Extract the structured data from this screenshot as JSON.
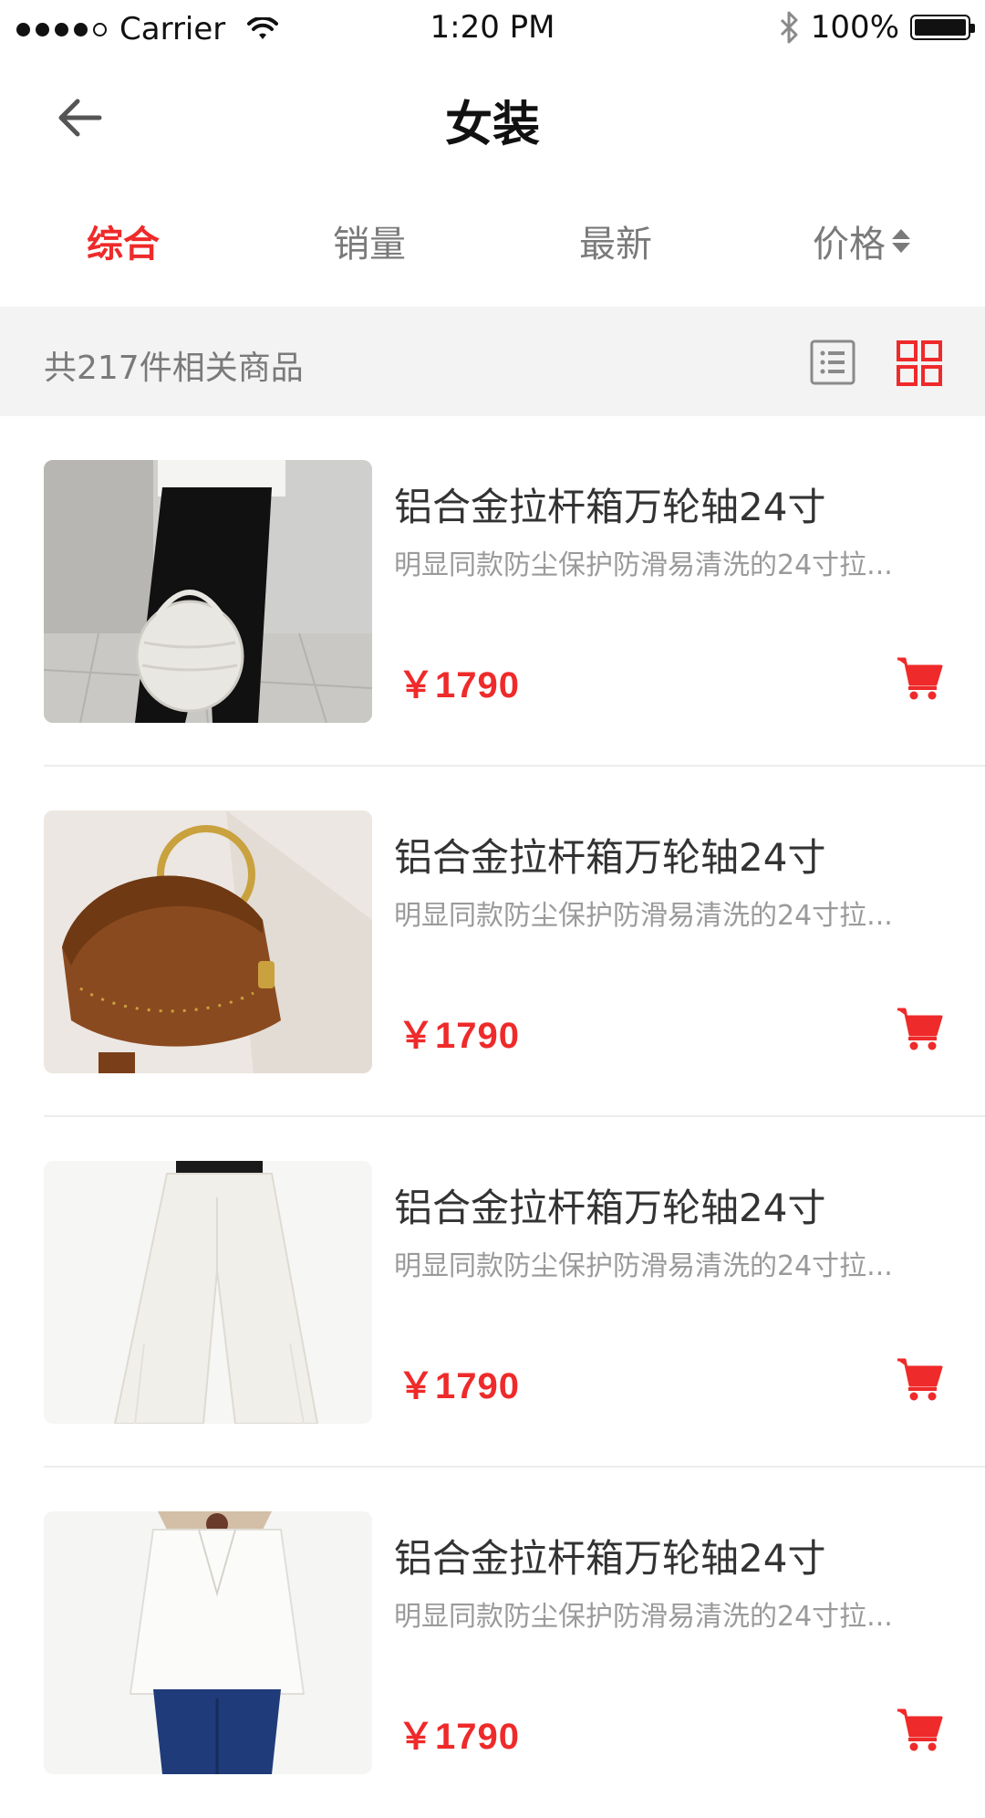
{
  "status": {
    "carrier": "Carrier",
    "time": "1:20 PM",
    "battery": "100%"
  },
  "nav": {
    "title": "女装"
  },
  "tabs": [
    "综合",
    "销量",
    "最新",
    "价格"
  ],
  "filter": {
    "count": "共217件相关商品"
  },
  "products": [
    {
      "name": "铝合金拉杆箱万轮轴24寸",
      "desc": "明显同款防尘保护防滑易清洗的24寸拉...",
      "price": "￥1790"
    },
    {
      "name": "铝合金拉杆箱万轮轴24寸",
      "desc": "明显同款防尘保护防滑易清洗的24寸拉...",
      "price": "￥1790"
    },
    {
      "name": "铝合金拉杆箱万轮轴24寸",
      "desc": "明显同款防尘保护防滑易清洗的24寸拉...",
      "price": "￥1790"
    },
    {
      "name": "铝合金拉杆箱万轮轴24寸",
      "desc": "明显同款防尘保护防滑易清洗的24寸拉...",
      "price": "￥1790"
    }
  ],
  "colors": {
    "accent": "#ef2a2a",
    "muted": "#7a7a7a",
    "filter_bg": "#f3f3f3"
  },
  "icons": {
    "back": "arrow-left-icon",
    "list_view": "list-view-icon",
    "grid_view": "grid-view-icon",
    "cart": "cart-icon",
    "sort": "sort-arrows-icon"
  }
}
